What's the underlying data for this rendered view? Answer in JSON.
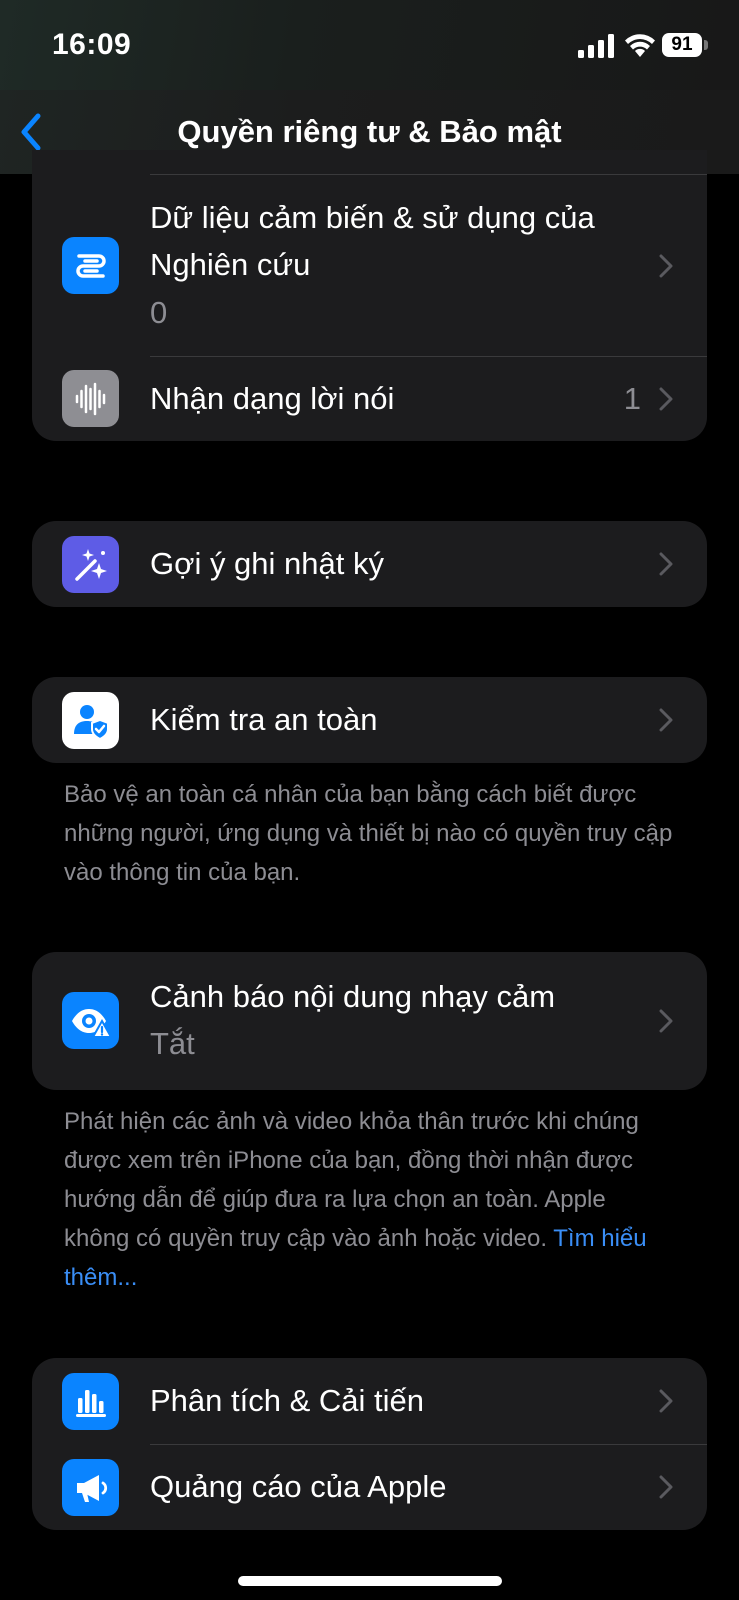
{
  "status": {
    "time": "16:09",
    "battery": "91"
  },
  "nav": {
    "title": "Quyền riêng tư & Bảo mật"
  },
  "rows": {
    "research": {
      "title_line1": "Dữ liệu cảm biến & sử dụng của",
      "title_line2": "Nghiên cứu",
      "subtitle": "0"
    },
    "speech": {
      "title": "Nhận dạng lời nói",
      "value": "1"
    },
    "journal": {
      "title": "Gợi ý ghi nhật ký"
    },
    "safety": {
      "title": "Kiểm tra an toàn"
    },
    "sensitive": {
      "title": "Cảnh báo nội dung nhạy cảm",
      "subtitle": "Tắt"
    },
    "analytics": {
      "title": "Phân tích & Cải tiến"
    },
    "ads": {
      "title": "Quảng cáo của Apple"
    }
  },
  "footnotes": {
    "safety": "Bảo vệ an toàn cá nhân của bạn bằng cách biết được những người, ứng dụng và thiết bị nào có quyền truy cập vào thông tin của bạn.",
    "sensitive": "Phát hiện các ảnh và video khỏa thân trước khi chúng được xem trên iPhone của bạn, đồng thời nhận được hướng dẫn để giúp đưa ra lựa chọn an toàn. Apple không có quyền truy cập vào ảnh hoặc video.",
    "sensitive_link": "Tìm hiểu thêm..."
  },
  "colors": {
    "accent_blue": "#0a84ff",
    "card_bg": "#1c1c1e",
    "secondary_text": "#8d8d93",
    "journal_purple": "#5e5ce6",
    "speech_gray": "#8e8e93"
  },
  "icons": {
    "research": "research-sensor-icon",
    "speech": "waveform-icon",
    "journal": "sparkles-wand-icon",
    "safety": "person-shield-icon",
    "sensitive": "eye-warning-icon",
    "analytics": "bar-chart-icon",
    "ads": "megaphone-icon"
  }
}
